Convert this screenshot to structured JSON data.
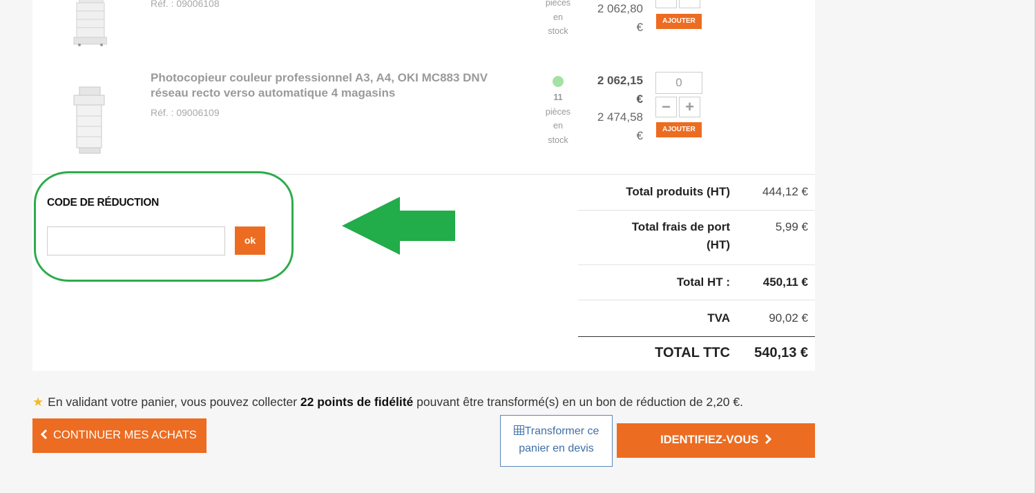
{
  "products": [
    {
      "ref": "Réf. : 09006108",
      "stock_lines": [
        "pièces",
        "en",
        "stock"
      ],
      "price_ht": "2 062,80",
      "currency": "€",
      "add_label": "AJOUTER"
    },
    {
      "title": "Photocopieur couleur professionnel A3, A4, OKI MC883 DNV réseau recto verso automatique 4 magasins",
      "ref": "Réf. : 09006109",
      "stock_count": "11",
      "stock_lines": [
        "pièces",
        "en",
        "stock"
      ],
      "price_ttc": "2 062,15",
      "price_ht": "2 474,58",
      "currency": "€",
      "qty": "0",
      "minus": "−",
      "plus": "+",
      "add_label": "AJOUTER"
    }
  ],
  "promo": {
    "title": "CODE DE RÉDUCTION",
    "input_value": "",
    "ok_label": "ok"
  },
  "totals": {
    "products_label": "Total produits (HT)",
    "products_value": "444,12 €",
    "shipping_label_1": "Total frais de port",
    "shipping_label_2": "(HT)",
    "shipping_value": "5,99 €",
    "total_ht_label": "Total HT :",
    "total_ht_value": "450,11 €",
    "tva_label": "TVA",
    "tva_value": "90,02 €",
    "total_ttc_label": "TOTAL TTC",
    "total_ttc_value": "540,13 €"
  },
  "loyalty": {
    "before": "En validant votre panier, vous pouvez collecter ",
    "points": "22 points de fidélité",
    "after": " pouvant être transformé(s) en un bon de réduction de 2,20 €."
  },
  "actions": {
    "continue_label": "CONTINUER MES ACHATS",
    "devis_line1": "Transformer ce",
    "devis_line2": "panier en devis",
    "identify_label": "IDENTIFIEZ-VOUS"
  },
  "colors": {
    "accent": "#ec6c21",
    "highlight": "#2dab4d",
    "stock_dot": "#a3e2a5",
    "link": "#3e6fa6"
  }
}
